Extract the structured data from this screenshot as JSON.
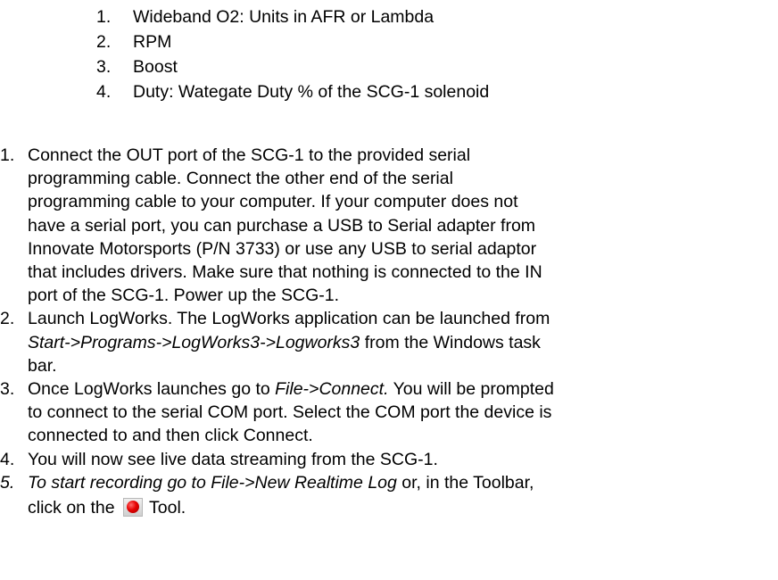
{
  "sub_list": [
    {
      "num": "1.",
      "text": "Wideband O2: Units in AFR or Lambda"
    },
    {
      "num": "2.",
      "text": "RPM"
    },
    {
      "num": "3.",
      "text": "Boost"
    },
    {
      "num": "4.",
      "text": "Duty: Wategate Duty % of the SCG-1 solenoid"
    }
  ],
  "steps": {
    "s1": {
      "num": "1.",
      "lines": [
        "Connect the OUT port of the SCG-1 to the provided serial",
        "programming cable. Connect the other end of the serial",
        "programming cable to your computer. If your computer does not",
        "have a serial port, you can purchase a USB to Serial adapter from",
        "Innovate Motorsports (P/N 3733) or use any USB to serial adaptor",
        "that includes drivers. Make sure that nothing is connected to the IN",
        "port of the SCG-1. Power up the SCG-1."
      ]
    },
    "s2": {
      "num": "2.",
      "line1": "Launch LogWorks. The LogWorks application can be launched from",
      "path": "Start->Programs->LogWorks3->Logworks3",
      "after_path": " from the Windows task",
      "line3": "bar."
    },
    "s3": {
      "num": "3.",
      "lead": "Once LogWorks launches go to ",
      "menu": "File->Connect.",
      "tail": " You will be prompted",
      "line2": "to connect to the serial COM port.  Select the COM port the device is",
      "line3": "connected to and then click Connect."
    },
    "s4": {
      "num": "4.",
      "text": "You will now see live data streaming from the SCG-1."
    },
    "s5": {
      "num": "5.",
      "italic": "To start recording go to File->New Realtime Log",
      "tail": " or, in the Toolbar,",
      "line2_a": "click on the ",
      "line2_b": " Tool."
    }
  },
  "icons": {
    "record": "record-icon",
    "record_color": "#e60000"
  }
}
